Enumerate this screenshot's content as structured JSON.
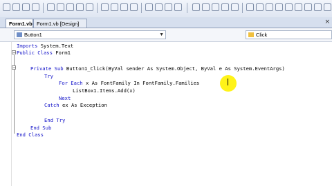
{
  "tabs": [
    {
      "label": "Form1.vb"
    },
    {
      "label": "Form1.vb [Design]"
    }
  ],
  "tab_close_label": "×",
  "class_combo": {
    "value": "Button1"
  },
  "method_combo": {
    "value": "Click"
  },
  "code_lines": [
    {
      "pre": "Imports System.Text",
      "kw": ""
    },
    {
      "kw": "Public Class",
      "rest": " Form1"
    },
    {
      "kw": "Private Sub",
      "rest": " Button1_Click(ByVal sender As System.Object, ByVal e As System.EventArgs)"
    },
    {
      "kw": "Try",
      "rest": ""
    },
    {
      "kw": "For Each",
      "rest": " x As FontFamily In FontFamily.Families"
    },
    {
      "kw": "",
      "rest": "ListBox1.Items.Add(x)"
    },
    {
      "kw": "Next",
      "rest": ""
    },
    {
      "kw": "Catch",
      "rest": " ex As Exception"
    },
    {
      "kw": "",
      "rest": ""
    },
    {
      "kw": "End Try",
      "rest": ""
    },
    {
      "kw": "End Sub",
      "rest": ""
    },
    {
      "kw": "End Class",
      "rest": ""
    }
  ],
  "colors": {
    "keyword": "#1010c8",
    "cursor_highlight": "#fff200"
  }
}
